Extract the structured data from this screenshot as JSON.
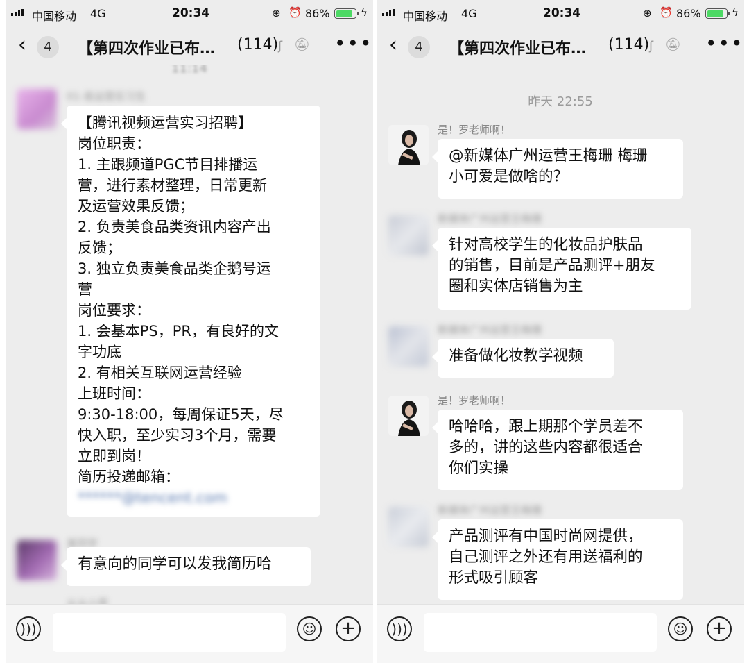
{
  "status": {
    "carrier": "中国移动",
    "network": "4G",
    "time": "20:34",
    "battery": "86%",
    "battery_level": 0.86,
    "accent_green": "#4cd964"
  },
  "nav": {
    "back_icon": "chevron-left-icon",
    "unread": "4",
    "title": "【第四次作业已布…",
    "count": "(114)",
    "more": "•••"
  },
  "left_chat": {
    "timestamp_partial": "11:14",
    "messages": [
      {
        "lines": [
          "【腾讯视频运营实习招聘】",
          "岗位职责：",
          "1. 主跟频道PGC节目排播运",
          "营，进行素材整理，日常更新",
          "及运营效果反馈；",
          "2. 负责美食品类资讯内容产出",
          "反馈；",
          "3. 独立负责美食品类企鹅号运",
          "营",
          "岗位要求：",
          "1. 会基本PS，PR，有良好的文",
          "字功底",
          "2. 有相关互联网运营经验",
          "上班时间：",
          "9:30-18:00，每周保证5天，尽",
          "快入职，至少实习3个月，需要",
          "立即到岗！",
          "简历投递邮箱："
        ],
        "email_blurred": "******@tencent.com"
      },
      {
        "text": "有意向的同学可以发我简历哈"
      }
    ]
  },
  "right_chat": {
    "timestamp": "昨天 22:55",
    "messages": [
      {
        "sender": "是！罗老师啊！",
        "lines": [
          "@新媒体广州运营王梅珊 梅珊",
          "小可爱是做啥的？"
        ]
      },
      {
        "sender_blurred": "新媒体广州运营王梅珊",
        "lines": [
          "针对高校学生的化妆品护肤品",
          "的销售，目前是产品测评+朋友",
          "圈和实体店销售为主"
        ]
      },
      {
        "sender_blurred": "新媒体广州运营王梅珊",
        "lines": [
          "准备做化妆教学视频"
        ]
      },
      {
        "sender": "是！罗老师啊！",
        "lines": [
          "哈哈哈，跟上期那个学员差不",
          "多的，讲的这些内容都很适合",
          "你们实操"
        ]
      },
      {
        "sender_blurred": "新媒体广州运营王梅珊",
        "lines": [
          "产品测评有中国时尚网提供，",
          "自己测评之外还有用送福利的",
          "形式吸引顾客"
        ]
      }
    ]
  },
  "input": {
    "voice_icon": "voice-icon",
    "emoji_icon": "emoji-icon",
    "plus_icon": "plus-icon",
    "plus": "+"
  }
}
